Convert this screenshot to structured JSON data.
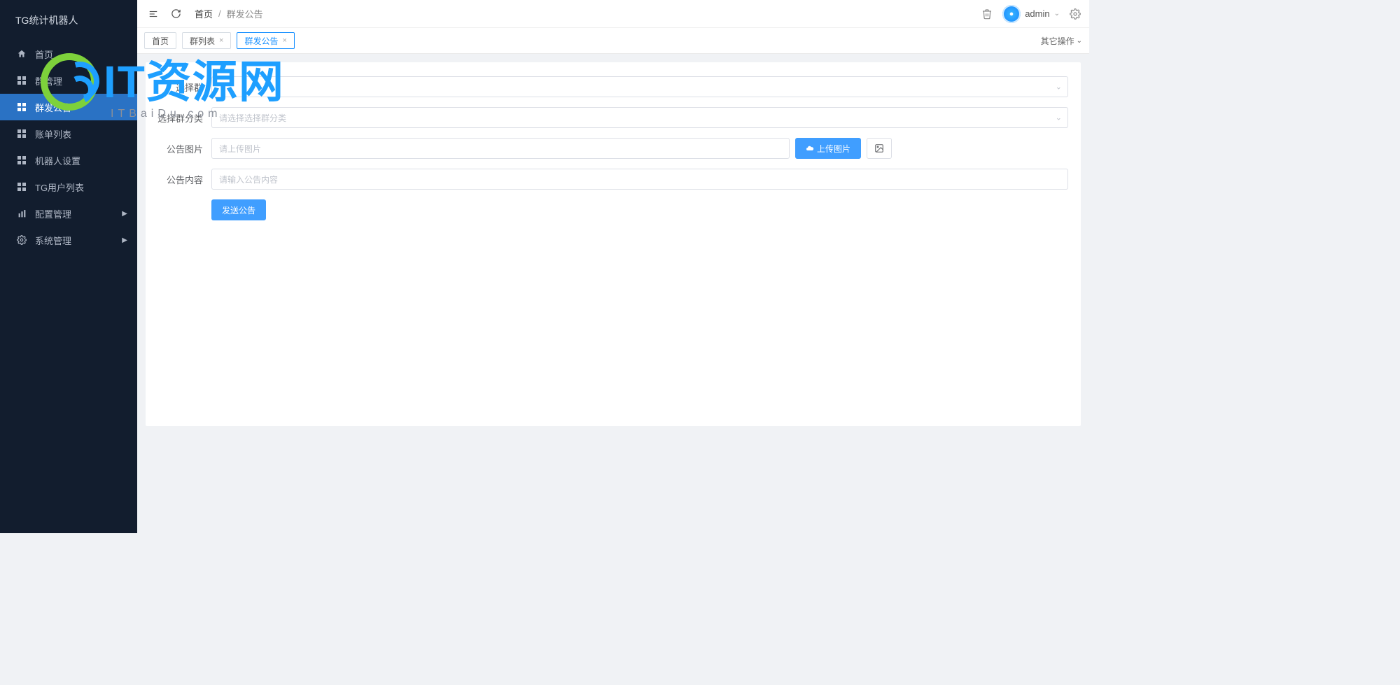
{
  "brand": "TG统计机器人",
  "sidebar": {
    "items": [
      {
        "icon": "home-icon",
        "label": "首页"
      },
      {
        "icon": "grid-icon",
        "label": "群管理"
      },
      {
        "icon": "grid-icon",
        "label": "群发公告"
      },
      {
        "icon": "grid-icon",
        "label": "账单列表"
      },
      {
        "icon": "grid-icon",
        "label": "机器人设置"
      },
      {
        "icon": "grid-icon",
        "label": "TG用户列表"
      },
      {
        "icon": "bars-icon",
        "label": "配置管理",
        "hasChildren": true
      },
      {
        "icon": "gear-icon",
        "label": "系统管理",
        "hasChildren": true
      }
    ],
    "activeIndex": 2
  },
  "topbar": {
    "breadcrumb": [
      "首页",
      "群发公告"
    ],
    "user": "admin"
  },
  "tabs": {
    "items": [
      {
        "label": "首页",
        "closable": false
      },
      {
        "label": "群列表",
        "closable": true
      },
      {
        "label": "群发公告",
        "closable": true
      }
    ],
    "activeIndex": 2,
    "moreLabel": "其它操作"
  },
  "form": {
    "row1": {
      "label": "选择群",
      "placeholder": ""
    },
    "row2": {
      "label": "选择群分类",
      "placeholder": "请选择选择群分类"
    },
    "row3": {
      "label": "公告图片",
      "placeholder": "请上传图片",
      "uploadBtn": "上传图片"
    },
    "row4": {
      "label": "公告内容",
      "placeholder": "请输入公告内容"
    },
    "submit": "发送公告"
  },
  "watermark": {
    "main": "IT资源网",
    "sub": "ITBaiDu.com"
  }
}
